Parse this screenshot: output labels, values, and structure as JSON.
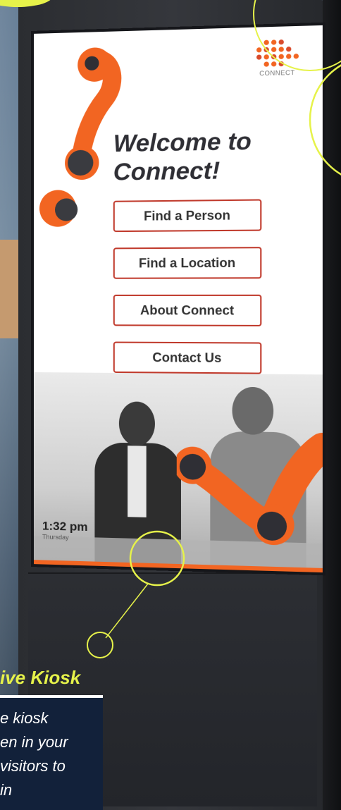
{
  "kiosk_screen": {
    "logo_text": "CONNECT",
    "title_line1": "Welcome to",
    "title_line2": "Connect!",
    "buttons": [
      {
        "label": "Find a Person"
      },
      {
        "label": "Find a Location"
      },
      {
        "label": "About Connect"
      },
      {
        "label": "Contact Us"
      }
    ],
    "time": "1:32 pm",
    "day": "Thursday"
  },
  "caption": {
    "title": "ive Kiosk",
    "lines": [
      "e kiosk",
      "en in your",
      "visitors to",
      "in"
    ]
  },
  "colors": {
    "accent_orange": "#f26522",
    "button_border": "#c0392b",
    "highlight_yellow": "#e6f24a",
    "caption_bg": "#12213a"
  }
}
